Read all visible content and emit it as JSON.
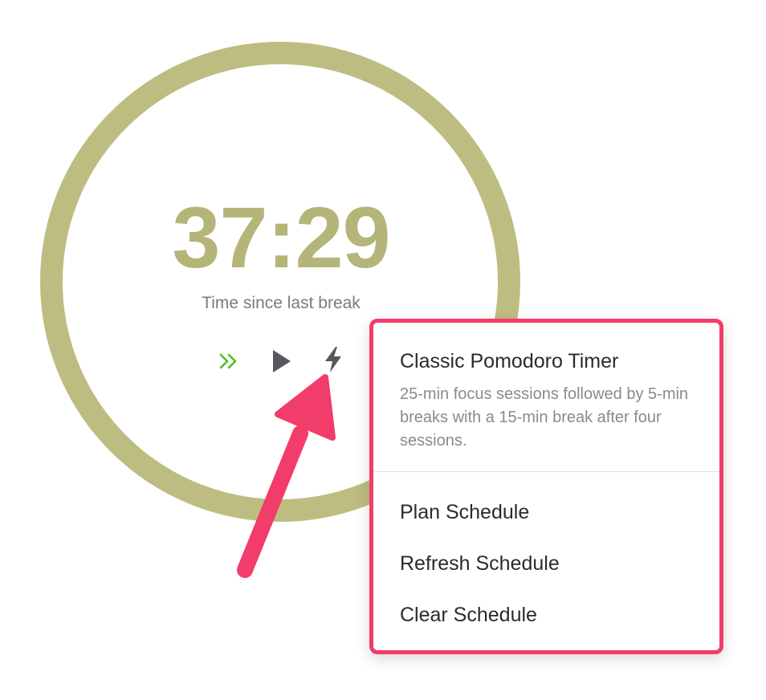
{
  "timer": {
    "elapsed": "37:29",
    "label": "Time since last break"
  },
  "controls": {
    "skip_icon": "double-chevron-right-icon",
    "play_icon": "play-icon",
    "bolt_icon": "lightning-bolt-icon"
  },
  "menu": {
    "title": "Classic Pomodoro Timer",
    "description": "25-min focus sessions followed by 5-min breaks with a 15-min break after four sessions.",
    "items": [
      {
        "label": "Plan Schedule"
      },
      {
        "label": "Refresh Schedule"
      },
      {
        "label": "Clear Schedule"
      }
    ]
  },
  "colors": {
    "ring": "#bdbd82",
    "time": "#b5b57a",
    "skip": "#4cc11f",
    "icons": "#58585d",
    "highlight": "#f23c6a"
  }
}
